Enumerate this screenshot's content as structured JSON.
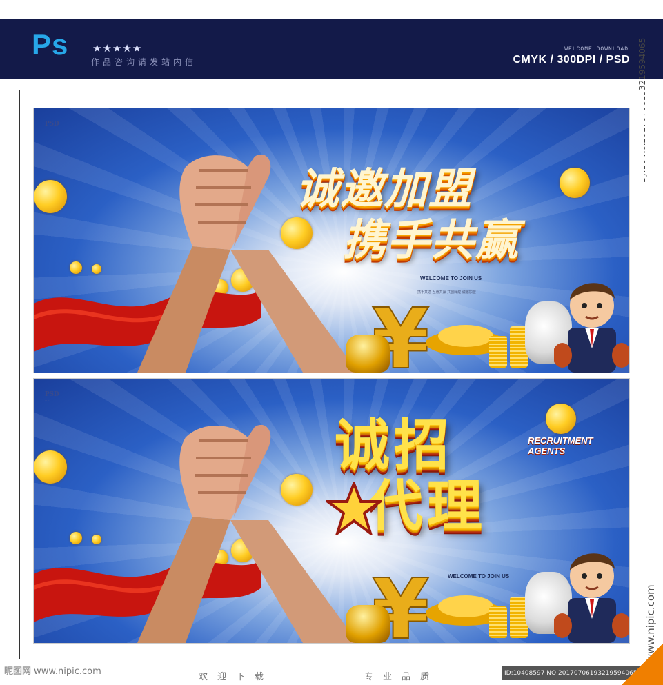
{
  "header": {
    "app_logo": "Ps",
    "stars": "★★★★★",
    "consult_text": "作品咨询请发站内信",
    "welcome_small": "WELCOME DOWNLOAD",
    "format": "CMYK / 300DPI / PSD",
    "side_id": "By:16 No.20170706193219594065"
  },
  "banner1": {
    "corner_logo": "PSD",
    "title_line1": "诚邀加盟",
    "title_line2": "携手共赢",
    "welcome": "WELCOME TO JOIN US",
    "welcome_sub": "携手共进 互惠共赢 共创辉煌 诚邀加盟",
    "yuan_symbol": "¥"
  },
  "banner2": {
    "corner_logo": "PSD",
    "title_line1": "诚招",
    "title_line2": "代理",
    "recruit_line1": "RECRUITMENT",
    "recruit_line2": "AGENTS",
    "welcome": "WELCOME TO JOIN US",
    "yuan_symbol": "¥"
  },
  "footer": {
    "site_logo": "昵图网",
    "site_url": "www.nipic.com",
    "slogan_left": "欢迎下载",
    "slogan_right": "专业品质",
    "id_text": "ID:10408597 NO:20170706193219594065",
    "side_url": "www.nipic.com"
  }
}
